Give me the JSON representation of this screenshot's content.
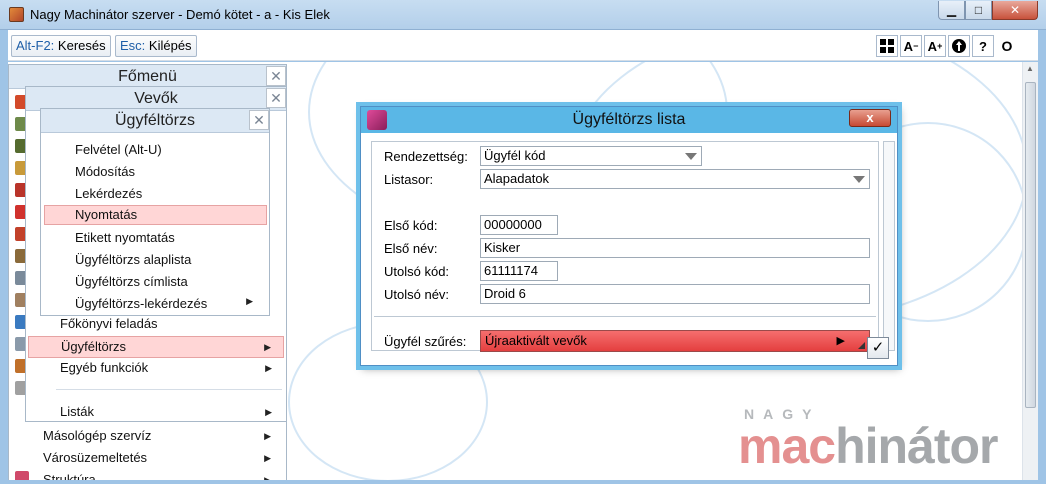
{
  "window": {
    "title": "Nagy Machinátor szerver - Demó kötet - a - Kis Elek",
    "minimize": "▁",
    "maximize": "□",
    "close": "✕"
  },
  "toolbar": {
    "search_key": "Alt-F2:",
    "search_label": "Keresés",
    "exit_key": "Esc:",
    "exit_label": "Kilépés",
    "icons": [
      "grid-icon",
      "font-smaller-icon",
      "font-larger-icon",
      "remote-icon",
      "help-icon"
    ],
    "font_minus": "A",
    "font_plus": "A",
    "help": "?",
    "circle": "O"
  },
  "menus": {
    "main": {
      "title": "Főmenü"
    },
    "vevok": {
      "title": "Vevők",
      "items": [
        {
          "label": "Főkönyvi feladás"
        },
        {
          "label": "Ügyféltörzs",
          "highlighted": true,
          "submenu": true
        },
        {
          "label": "Egyéb funkciók",
          "submenu": true
        },
        {
          "label": "Listák",
          "submenu": true
        }
      ]
    },
    "main_items": [
      {
        "label": "Másológép szervíz",
        "submenu": true
      },
      {
        "label": "Városüzemeltetés",
        "submenu": true
      },
      {
        "label": "Struktúra",
        "submenu": true
      }
    ],
    "ugyfel": {
      "title": "Ügyféltörzs",
      "items": [
        {
          "label": "Felvétel (Alt-U)"
        },
        {
          "label": "Módosítás"
        },
        {
          "label": "Lekérdezés"
        },
        {
          "label": "Nyomtatás",
          "highlighted": true
        },
        {
          "label": "Etikett nyomtatás"
        },
        {
          "label": "Ügyféltörzs alaplista"
        },
        {
          "label": "Ügyféltörzs címlista"
        },
        {
          "label": "Ügyféltörzs-lekérdezés",
          "submenu": true
        }
      ]
    },
    "close_glyph": "✕",
    "submenu_arrow": "▶"
  },
  "dialog": {
    "title": "Ügyféltörzs lista",
    "close": "x",
    "rendezettseg_label": "Rendezettség:",
    "rendezettseg_value": "Ügyfél kód",
    "listasor_label": "Listasor:",
    "listasor_value": "Alapadatok",
    "elso_kod_label": "Első kód:",
    "elso_kod_value": "00000000",
    "elso_nev_label": "Első név:",
    "elso_nev_value": "Kisker",
    "utolso_kod_label": "Utolsó kód:",
    "utolso_kod_value": "61111174",
    "utolso_nev_label": "Utolsó név:",
    "utolso_nev_value": "Droid 6",
    "szures_label": "Ügyfél szűrés:",
    "szures_value": "Újraaktivált vevők",
    "play": "▶",
    "ok": "✓"
  },
  "logo": {
    "top": "NAGY",
    "main_a": "mac",
    "main_b": "hinátor"
  },
  "colors": {
    "titlebar": "#b3cfea",
    "dialog_titlebar": "#5ab7e6",
    "highlight": "#ffd6d6",
    "filter": "#e43f3f"
  }
}
